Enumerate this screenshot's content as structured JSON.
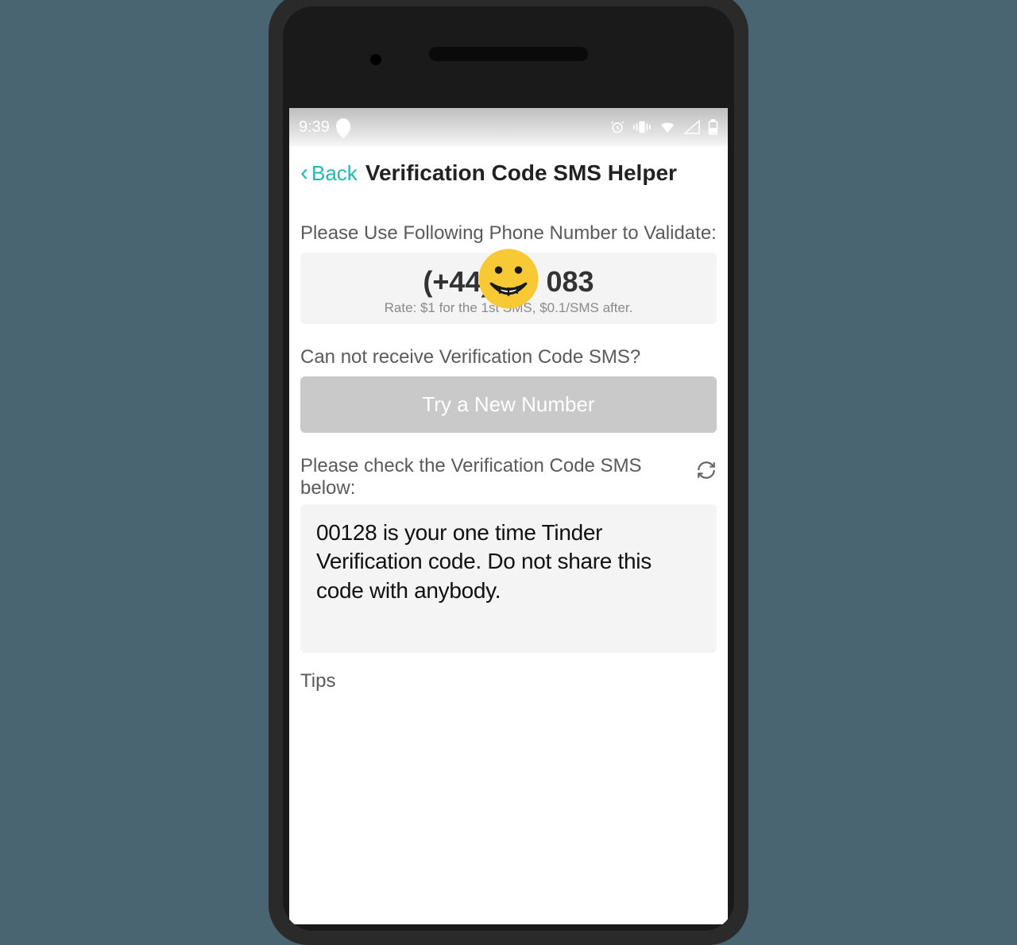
{
  "status": {
    "time": "9:39"
  },
  "nav": {
    "back": "Back",
    "title": "Verification Code SMS Helper"
  },
  "sections": {
    "phone_label": "Please Use Following Phone Number to Validate:",
    "phone_number": "(+44)786       083",
    "rate": "Rate: $1 for the 1st SMS, $0.1/SMS after.",
    "cannot_receive": "Can not receive Verification Code SMS?",
    "try_button": "Try a New Number",
    "check_label": "Please check the Verification Code SMS below:",
    "sms_text": "00128 is your one time Tinder Verification code. Do not share this code with anybody.",
    "tips": "Tips"
  }
}
